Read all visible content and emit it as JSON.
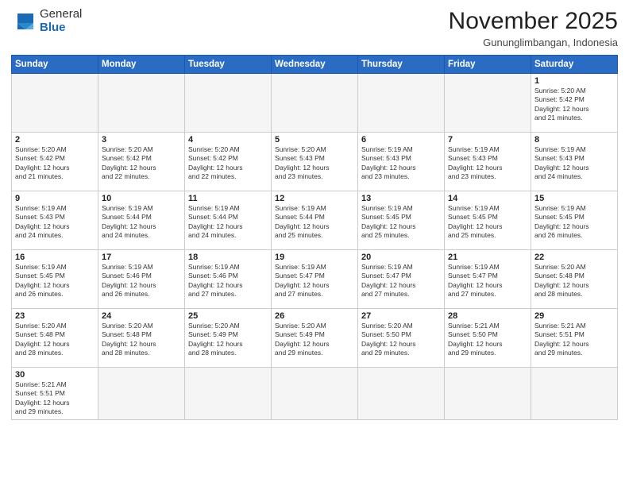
{
  "logo": {
    "general": "General",
    "blue": "Blue"
  },
  "title": "November 2025",
  "subtitle": "Gununglimbangan, Indonesia",
  "days_of_week": [
    "Sunday",
    "Monday",
    "Tuesday",
    "Wednesday",
    "Thursday",
    "Friday",
    "Saturday"
  ],
  "weeks": [
    [
      {
        "day": "",
        "info": ""
      },
      {
        "day": "",
        "info": ""
      },
      {
        "day": "",
        "info": ""
      },
      {
        "day": "",
        "info": ""
      },
      {
        "day": "",
        "info": ""
      },
      {
        "day": "",
        "info": ""
      },
      {
        "day": "1",
        "info": "Sunrise: 5:20 AM\nSunset: 5:42 PM\nDaylight: 12 hours\nand 21 minutes."
      }
    ],
    [
      {
        "day": "2",
        "info": "Sunrise: 5:20 AM\nSunset: 5:42 PM\nDaylight: 12 hours\nand 21 minutes."
      },
      {
        "day": "3",
        "info": "Sunrise: 5:20 AM\nSunset: 5:42 PM\nDaylight: 12 hours\nand 22 minutes."
      },
      {
        "day": "4",
        "info": "Sunrise: 5:20 AM\nSunset: 5:42 PM\nDaylight: 12 hours\nand 22 minutes."
      },
      {
        "day": "5",
        "info": "Sunrise: 5:20 AM\nSunset: 5:43 PM\nDaylight: 12 hours\nand 23 minutes."
      },
      {
        "day": "6",
        "info": "Sunrise: 5:19 AM\nSunset: 5:43 PM\nDaylight: 12 hours\nand 23 minutes."
      },
      {
        "day": "7",
        "info": "Sunrise: 5:19 AM\nSunset: 5:43 PM\nDaylight: 12 hours\nand 23 minutes."
      },
      {
        "day": "8",
        "info": "Sunrise: 5:19 AM\nSunset: 5:43 PM\nDaylight: 12 hours\nand 24 minutes."
      }
    ],
    [
      {
        "day": "9",
        "info": "Sunrise: 5:19 AM\nSunset: 5:43 PM\nDaylight: 12 hours\nand 24 minutes."
      },
      {
        "day": "10",
        "info": "Sunrise: 5:19 AM\nSunset: 5:44 PM\nDaylight: 12 hours\nand 24 minutes."
      },
      {
        "day": "11",
        "info": "Sunrise: 5:19 AM\nSunset: 5:44 PM\nDaylight: 12 hours\nand 24 minutes."
      },
      {
        "day": "12",
        "info": "Sunrise: 5:19 AM\nSunset: 5:44 PM\nDaylight: 12 hours\nand 25 minutes."
      },
      {
        "day": "13",
        "info": "Sunrise: 5:19 AM\nSunset: 5:45 PM\nDaylight: 12 hours\nand 25 minutes."
      },
      {
        "day": "14",
        "info": "Sunrise: 5:19 AM\nSunset: 5:45 PM\nDaylight: 12 hours\nand 25 minutes."
      },
      {
        "day": "15",
        "info": "Sunrise: 5:19 AM\nSunset: 5:45 PM\nDaylight: 12 hours\nand 26 minutes."
      }
    ],
    [
      {
        "day": "16",
        "info": "Sunrise: 5:19 AM\nSunset: 5:45 PM\nDaylight: 12 hours\nand 26 minutes."
      },
      {
        "day": "17",
        "info": "Sunrise: 5:19 AM\nSunset: 5:46 PM\nDaylight: 12 hours\nand 26 minutes."
      },
      {
        "day": "18",
        "info": "Sunrise: 5:19 AM\nSunset: 5:46 PM\nDaylight: 12 hours\nand 27 minutes."
      },
      {
        "day": "19",
        "info": "Sunrise: 5:19 AM\nSunset: 5:47 PM\nDaylight: 12 hours\nand 27 minutes."
      },
      {
        "day": "20",
        "info": "Sunrise: 5:19 AM\nSunset: 5:47 PM\nDaylight: 12 hours\nand 27 minutes."
      },
      {
        "day": "21",
        "info": "Sunrise: 5:19 AM\nSunset: 5:47 PM\nDaylight: 12 hours\nand 27 minutes."
      },
      {
        "day": "22",
        "info": "Sunrise: 5:20 AM\nSunset: 5:48 PM\nDaylight: 12 hours\nand 28 minutes."
      }
    ],
    [
      {
        "day": "23",
        "info": "Sunrise: 5:20 AM\nSunset: 5:48 PM\nDaylight: 12 hours\nand 28 minutes."
      },
      {
        "day": "24",
        "info": "Sunrise: 5:20 AM\nSunset: 5:48 PM\nDaylight: 12 hours\nand 28 minutes."
      },
      {
        "day": "25",
        "info": "Sunrise: 5:20 AM\nSunset: 5:49 PM\nDaylight: 12 hours\nand 28 minutes."
      },
      {
        "day": "26",
        "info": "Sunrise: 5:20 AM\nSunset: 5:49 PM\nDaylight: 12 hours\nand 29 minutes."
      },
      {
        "day": "27",
        "info": "Sunrise: 5:20 AM\nSunset: 5:50 PM\nDaylight: 12 hours\nand 29 minutes."
      },
      {
        "day": "28",
        "info": "Sunrise: 5:21 AM\nSunset: 5:50 PM\nDaylight: 12 hours\nand 29 minutes."
      },
      {
        "day": "29",
        "info": "Sunrise: 5:21 AM\nSunset: 5:51 PM\nDaylight: 12 hours\nand 29 minutes."
      }
    ],
    [
      {
        "day": "30",
        "info": "Sunrise: 5:21 AM\nSunset: 5:51 PM\nDaylight: 12 hours\nand 29 minutes."
      },
      {
        "day": "",
        "info": ""
      },
      {
        "day": "",
        "info": ""
      },
      {
        "day": "",
        "info": ""
      },
      {
        "day": "",
        "info": ""
      },
      {
        "day": "",
        "info": ""
      },
      {
        "day": "",
        "info": ""
      }
    ]
  ]
}
